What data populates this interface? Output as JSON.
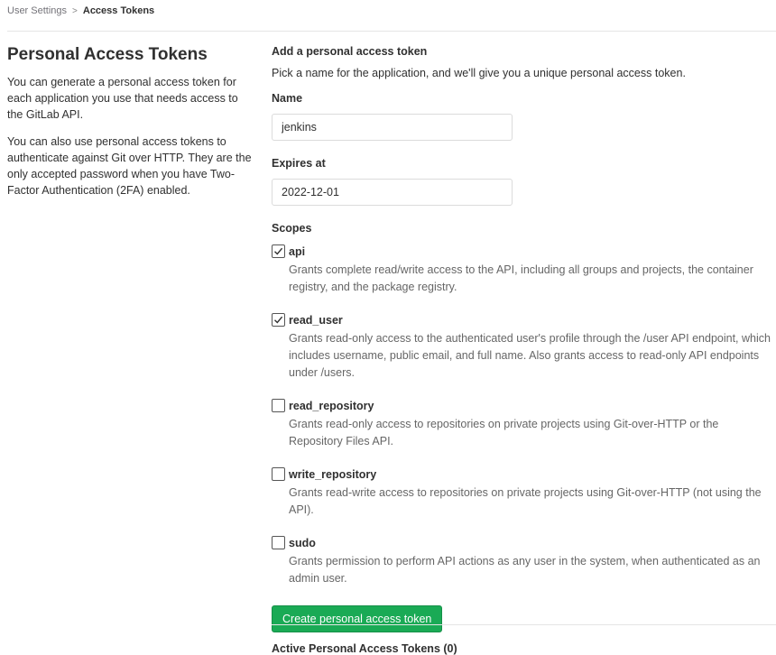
{
  "breadcrumb": {
    "parent": "User Settings",
    "separator": ">",
    "current": "Access Tokens"
  },
  "left": {
    "title": "Personal Access Tokens",
    "para1": "You can generate a personal access token for each application you use that needs access to the GitLab API.",
    "para2": "You can also use personal access tokens to authenticate against Git over HTTP. They are the only accepted password when you have Two-Factor Authentication (2FA) enabled."
  },
  "form": {
    "title": "Add a personal access token",
    "description": "Pick a name for the application, and we'll give you a unique personal access token.",
    "name_label": "Name",
    "name_value": "jenkins",
    "expires_label": "Expires at",
    "expires_value": "2022-12-01",
    "scopes_label": "Scopes",
    "scopes": [
      {
        "name": "api",
        "checked": true,
        "description": "Grants complete read/write access to the API, including all groups and projects, the container registry, and the package registry."
      },
      {
        "name": "read_user",
        "checked": true,
        "description": "Grants read-only access to the authenticated user's profile through the /user API endpoint, which includes username, public email, and full name. Also grants access to read-only API endpoints under /users."
      },
      {
        "name": "read_repository",
        "checked": false,
        "description": "Grants read-only access to repositories on private projects using Git-over-HTTP or the Repository Files API."
      },
      {
        "name": "write_repository",
        "checked": false,
        "description": "Grants read-write access to repositories on private projects using Git-over-HTTP (not using the API)."
      },
      {
        "name": "sudo",
        "checked": false,
        "description": "Grants permission to perform API actions as any user in the system, when authenticated as an admin user."
      }
    ],
    "submit_label": "Create personal access token"
  },
  "active_tokens_title": "Active Personal Access Tokens (0)",
  "colors": {
    "primary_button": "#1aaa55",
    "text": "#303030",
    "muted": "#666666"
  }
}
